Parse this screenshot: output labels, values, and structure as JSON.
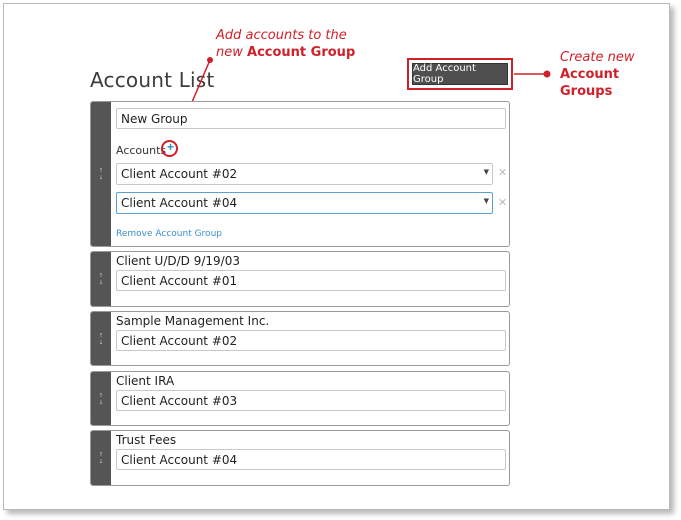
{
  "page_title": "Account List",
  "add_button_label": "Add Account Group",
  "annotations": {
    "top_line1": "Add accounts to the",
    "top_line2_prefix": "new ",
    "top_line2_bold": "Account Group",
    "right_line1": "Create new",
    "right_line2": "Account",
    "right_line3": "Groups"
  },
  "new_group": {
    "name_value": "New Group",
    "accounts_label": "Accounts",
    "add_icon": "+",
    "selects": [
      "Client Account #02",
      "Client Account #04"
    ],
    "remove_label": "Remove Account Group"
  },
  "groups": [
    {
      "title": "Client U/D/D 9/19/03",
      "account": "Client Account #01"
    },
    {
      "title": "Sample Management Inc.",
      "account": "Client Account #02"
    },
    {
      "title": "Client IRA",
      "account": "Client Account #03"
    },
    {
      "title": "Trust Fees",
      "account": "Client Account #04"
    }
  ],
  "icons": {
    "handle": "drag-handle-icon",
    "remove": "close-icon",
    "caret": "caret-down-icon"
  },
  "colors": {
    "annotation_red": "#d0202a",
    "handle_gray": "#555555",
    "link_blue": "#3b8fce",
    "button_dark": "#4f4f4f"
  }
}
